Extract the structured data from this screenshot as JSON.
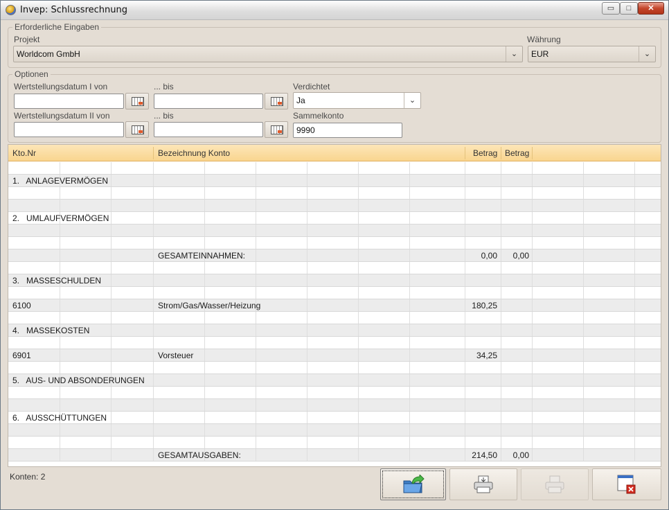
{
  "window": {
    "title": "Invep: Schlussrechnung",
    "controls": {
      "minimize": "▭",
      "maximize": "□",
      "close": "✕"
    }
  },
  "required": {
    "legend": "Erforderliche Eingaben",
    "project_label": "Projekt",
    "project_value": "Worldcom GmbH",
    "currency_label": "Währung",
    "currency_value": "EUR"
  },
  "options": {
    "legend": "Optionen",
    "date1_from_label": "Wertstellungsdatum I von",
    "date1_to_label": "... bis",
    "date2_from_label": "Wertstellungsdatum II von",
    "date2_to_label": "... bis",
    "date1_from_value": "",
    "date1_to_value": "",
    "date2_from_value": "",
    "date2_to_value": "",
    "condensed_label": "Verdichtet",
    "condensed_value": "Ja",
    "collective_label": "Sammelkonto",
    "collective_value": "9990"
  },
  "table": {
    "columns": [
      "Kto.Nr",
      "Bezeichnung Konto",
      "Betrag",
      "Betrag"
    ],
    "rows": [
      {
        "kto": "",
        "bez": "",
        "b1": "",
        "b2": ""
      },
      {
        "kto": "1.   ANLAGEVERMÖGEN",
        "bez": "",
        "b1": "",
        "b2": ""
      },
      {
        "kto": "",
        "bez": "",
        "b1": "",
        "b2": ""
      },
      {
        "kto": "",
        "bez": "",
        "b1": "",
        "b2": ""
      },
      {
        "kto": "2.   UMLAUFVERMÖGEN",
        "bez": "",
        "b1": "",
        "b2": ""
      },
      {
        "kto": "",
        "bez": "",
        "b1": "",
        "b2": ""
      },
      {
        "kto": "",
        "bez": "",
        "b1": "",
        "b2": ""
      },
      {
        "kto": "",
        "bez": "GESAMTEINNAHMEN:",
        "b1": "0,00",
        "b2": "0,00"
      },
      {
        "kto": "",
        "bez": "",
        "b1": "",
        "b2": ""
      },
      {
        "kto": "3.   MASSESCHULDEN",
        "bez": "",
        "b1": "",
        "b2": ""
      },
      {
        "kto": "",
        "bez": "",
        "b1": "",
        "b2": ""
      },
      {
        "kto": "6100",
        "bez": "Strom/Gas/Wasser/Heizung",
        "b1": "180,25",
        "b2": ""
      },
      {
        "kto": "",
        "bez": "",
        "b1": "",
        "b2": ""
      },
      {
        "kto": "4.   MASSEKOSTEN",
        "bez": "",
        "b1": "",
        "b2": ""
      },
      {
        "kto": "",
        "bez": "",
        "b1": "",
        "b2": ""
      },
      {
        "kto": "6901",
        "bez": "Vorsteuer",
        "b1": "34,25",
        "b2": ""
      },
      {
        "kto": "",
        "bez": "",
        "b1": "",
        "b2": ""
      },
      {
        "kto": "5.   AUS- UND ABSONDERUNGEN",
        "bez": "",
        "b1": "",
        "b2": ""
      },
      {
        "kto": "",
        "bez": "",
        "b1": "",
        "b2": ""
      },
      {
        "kto": "",
        "bez": "",
        "b1": "",
        "b2": ""
      },
      {
        "kto": "6.   AUSSCHÜTTUNGEN",
        "bez": "",
        "b1": "",
        "b2": ""
      },
      {
        "kto": "",
        "bez": "",
        "b1": "",
        "b2": ""
      },
      {
        "kto": "",
        "bez": "",
        "b1": "",
        "b2": ""
      },
      {
        "kto": "",
        "bez": "GESAMTAUSGABEN:",
        "b1": "214,50",
        "b2": "0,00"
      }
    ]
  },
  "status": {
    "text": "Konten: 2"
  },
  "actions": [
    {
      "name": "open-folder-button",
      "icon": "folder-arrow-icon",
      "state": "focused"
    },
    {
      "name": "print-button",
      "icon": "printer-icon",
      "state": "enabled"
    },
    {
      "name": "print-preview-button",
      "icon": "printer-disabled-icon",
      "state": "disabled"
    },
    {
      "name": "close-window-button",
      "icon": "window-close-icon",
      "state": "enabled"
    }
  ]
}
